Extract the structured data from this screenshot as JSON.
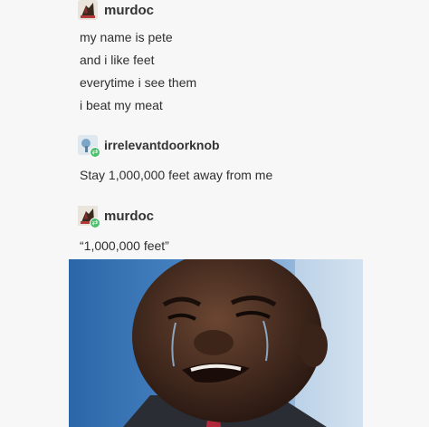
{
  "posts": [
    {
      "username": "murdoc",
      "avatar_icon": "murdoc-avatar-icon",
      "lines": [
        "my name is pete",
        "and i like feet",
        "everytime i see them",
        "i beat my meat"
      ]
    },
    {
      "username": "irrelevantdoorknob",
      "avatar_icon": "doorknob-avatar-icon",
      "lines": [
        "Stay 1,000,000 feet away from me"
      ]
    },
    {
      "username": "murdoc",
      "avatar_icon": "murdoc-avatar-icon",
      "lines": [
        "“1,000,000 feet”"
      ]
    }
  ],
  "image": {
    "subject": "crying-man-photo"
  },
  "colors": {
    "background": "#f7f7f7",
    "text": "#2f2f2f",
    "badge": "#4ebf6e"
  }
}
